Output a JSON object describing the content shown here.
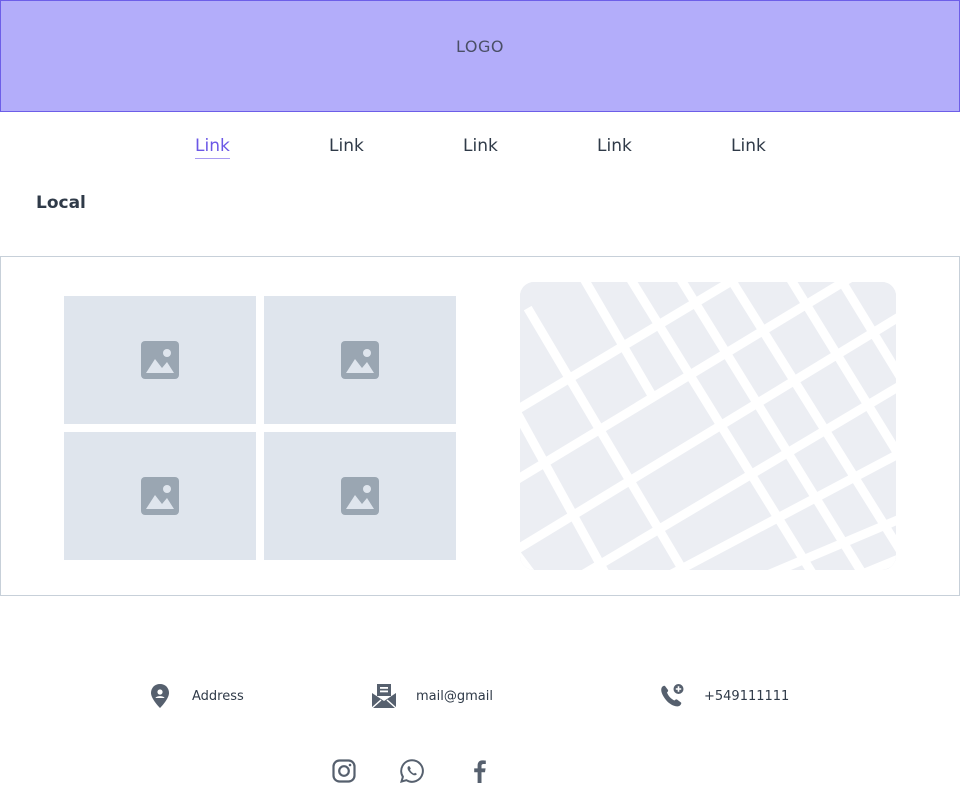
{
  "header": {
    "logo_text": "LOGO"
  },
  "nav": {
    "links": [
      {
        "label": "Link",
        "active": true
      },
      {
        "label": "Link",
        "active": false
      },
      {
        "label": "Link",
        "active": false
      },
      {
        "label": "Link",
        "active": false
      },
      {
        "label": "Link",
        "active": false
      }
    ]
  },
  "section": {
    "title": "Local"
  },
  "gallery": {
    "images": [
      {
        "icon": "image-placeholder-icon"
      },
      {
        "icon": "image-placeholder-icon"
      },
      {
        "icon": "image-placeholder-icon"
      },
      {
        "icon": "image-placeholder-icon"
      }
    ],
    "map_icon": "map-placeholder"
  },
  "contact": {
    "address": {
      "icon": "location-pin-icon",
      "text": "Address"
    },
    "email": {
      "icon": "envelope-open-icon",
      "text": "mail@gmail"
    },
    "phone": {
      "icon": "phone-plus-icon",
      "text": "+549111111"
    }
  },
  "social": [
    {
      "name": "instagram",
      "icon": "instagram-icon"
    },
    {
      "name": "whatsapp",
      "icon": "whatsapp-icon"
    },
    {
      "name": "facebook",
      "icon": "facebook-icon"
    }
  ],
  "colors": {
    "header_bg": "#b3adfa",
    "header_border": "#6d5ee8",
    "accent": "#6b57e6",
    "text": "#2f3a48",
    "placeholder_bg": "#dfe5ed",
    "placeholder_icon": "#9aa6b2",
    "icon": "#56606e"
  }
}
